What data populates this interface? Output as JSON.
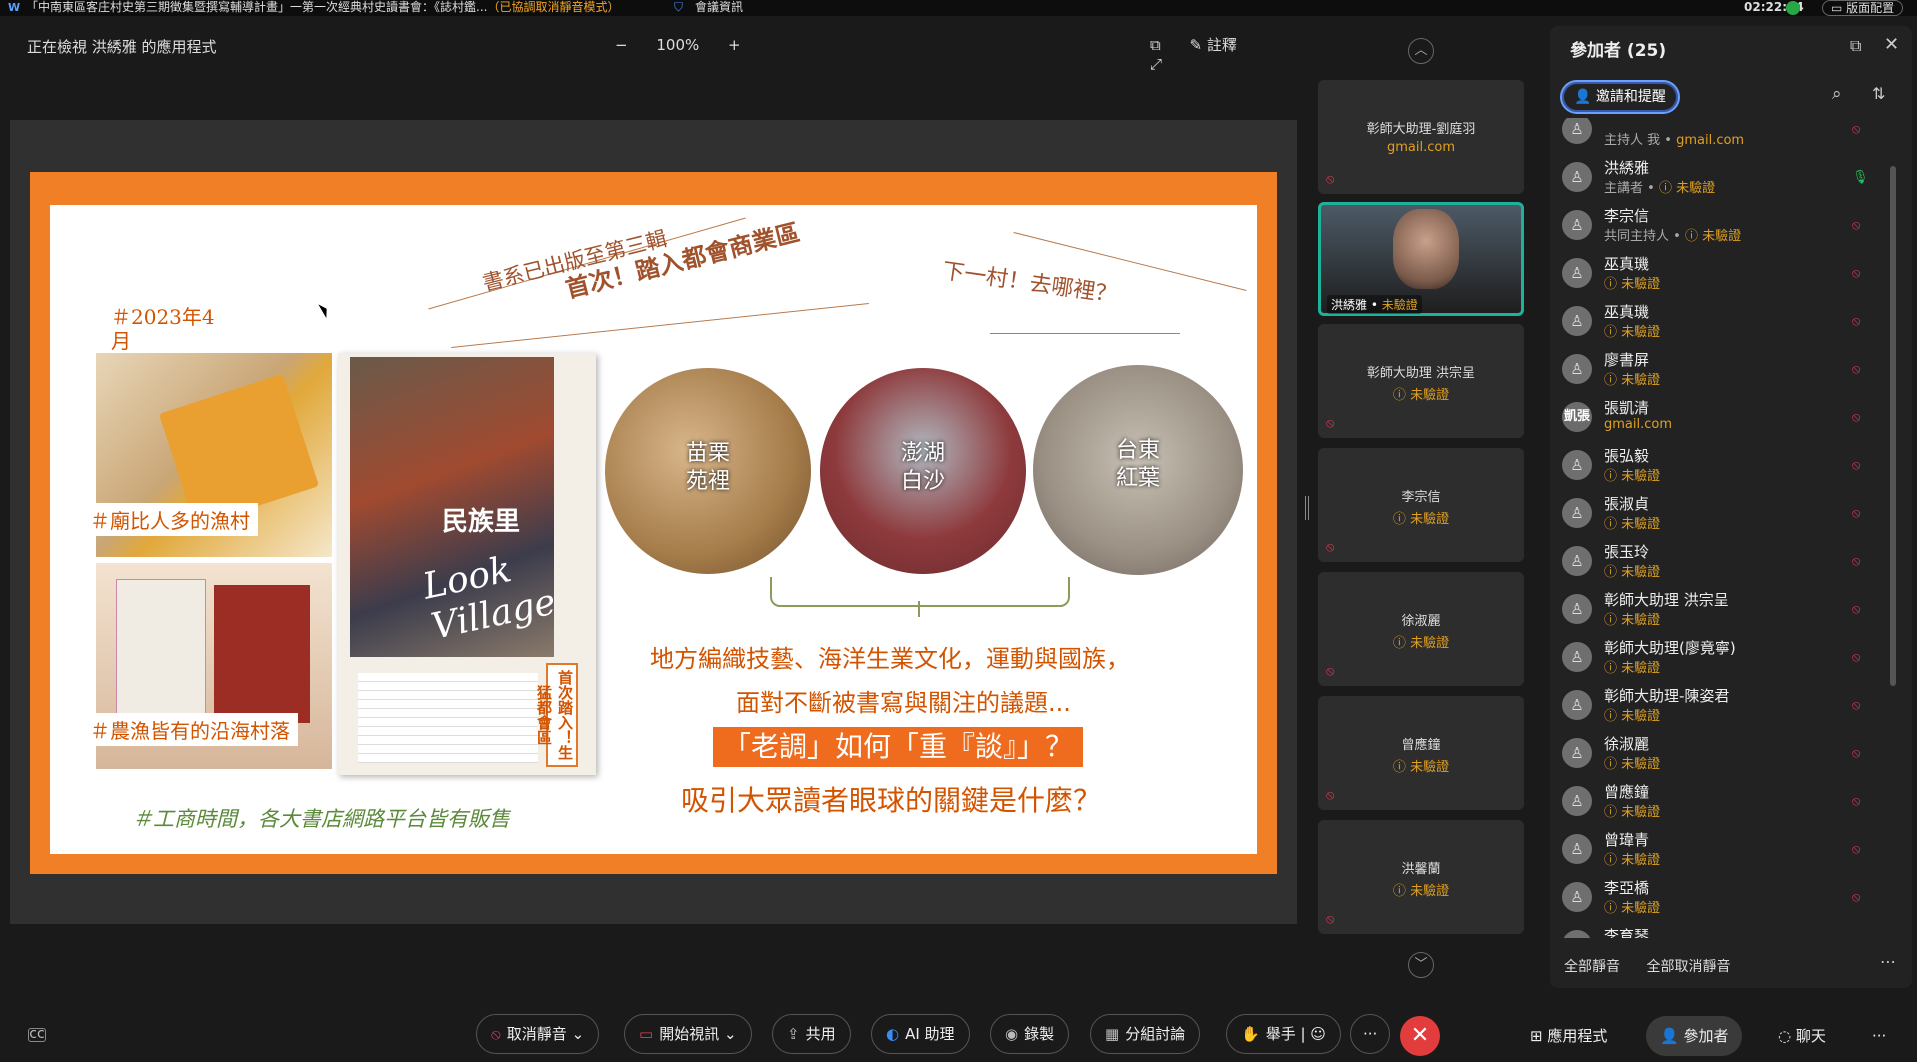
{
  "window": {
    "title": "「中南東區客庄村史第三期徵集暨撰寫輔導計畫」一第一次經典村史讀書會：《誌村鑑...",
    "title_hint": "（已協調取消靜音模式）",
    "meeting_info": "會議資訊",
    "clock": "02:22:44",
    "layout_label": "版面配置"
  },
  "viewer": {
    "viewing": "正在檢視 洪綉雅 的應用程式",
    "zoom_minus": "−",
    "zoom": "100%",
    "zoom_plus": "+",
    "annotate": "註釋"
  },
  "slide": {
    "date": "＃2023年4月",
    "headline1": "書系已出版至第三輯",
    "headline2": "首次！踏入都會商業區",
    "headline3": "下一村！去哪裡？",
    "label1": "＃廟比人多的漁村",
    "label2": "＃農漁皆有的沿海村落",
    "book_title": "民族里",
    "book_look": "Look Village",
    "book_tag": "首次踏入！生猛都會區",
    "circle1": "苗栗\n苑裡",
    "circle2": "澎湖\n白沙",
    "circle3": "台東\n紅葉",
    "text1": "地方編織技藝、海洋生業文化，運動與國族，",
    "text2": "面對不斷被書寫與關注的議題...",
    "text3": "「老調」如何「重『談』」？",
    "text4": "吸引大眾讀者眼球的關鍵是什麼？",
    "text5": "＃工商時間，各大書店網路平台皆有販售"
  },
  "tiles": [
    {
      "name": "彰師大助理-劉庭羽",
      "sub": "gmail.com",
      "sub_type": "email"
    },
    {
      "name": "洪綉雅",
      "sub": "未驗證",
      "video": true
    },
    {
      "name": "彰師大助理 洪宗呈",
      "sub": "未驗證"
    },
    {
      "name": "李宗信",
      "sub": "未驗證"
    },
    {
      "name": "徐淑麗",
      "sub": "未驗證"
    },
    {
      "name": "曾應鐘",
      "sub": "未驗證"
    },
    {
      "name": "洪馨蘭",
      "sub": "未驗證"
    }
  ],
  "panel": {
    "title": "參加者 (25)",
    "invite": "邀請和提醒",
    "mute_all": "全部靜音",
    "unmute_all": "全部取消靜音",
    "participants": [
      {
        "name": "",
        "role": "主持人 我 • ",
        "status": "gmail.com",
        "avatar": "",
        "mic": "muted"
      },
      {
        "name": "洪綉雅",
        "role": "主講者 • ",
        "status": "未驗證",
        "avatar": "",
        "mic": "on"
      },
      {
        "name": "李宗信",
        "role": "共同主持人 • ",
        "status": "未驗證",
        "avatar": "",
        "mic": "muted"
      },
      {
        "name": "巫真璣",
        "role": "",
        "status": "未驗證",
        "avatar": "",
        "mic": "muted"
      },
      {
        "name": "巫真璣",
        "role": "",
        "status": "未驗證",
        "avatar": "",
        "mic": "muted"
      },
      {
        "name": "廖書屏",
        "role": "",
        "status": "未驗證",
        "avatar": "",
        "mic": "muted"
      },
      {
        "name": "張凱清",
        "role": "",
        "status": "gmail.com",
        "avatar": "凱張",
        "mic": "muted"
      },
      {
        "name": "張弘毅",
        "role": "",
        "status": "未驗證",
        "avatar": "",
        "mic": "muted"
      },
      {
        "name": "張淑貞",
        "role": "",
        "status": "未驗證",
        "avatar": "",
        "mic": "muted"
      },
      {
        "name": "張玉玲",
        "role": "",
        "status": "未驗證",
        "avatar": "",
        "mic": "muted"
      },
      {
        "name": "彰師大助理 洪宗呈",
        "role": "",
        "status": "未驗證",
        "avatar": "",
        "mic": "muted"
      },
      {
        "name": "彰師大助理(廖竟寧)",
        "role": "",
        "status": "未驗證",
        "avatar": "",
        "mic": "muted"
      },
      {
        "name": "彰師大助理-陳姿君",
        "role": "",
        "status": "未驗證",
        "avatar": "",
        "mic": "muted"
      },
      {
        "name": "徐淑麗",
        "role": "",
        "status": "未驗證",
        "avatar": "",
        "mic": "muted"
      },
      {
        "name": "曾應鐘",
        "role": "",
        "status": "未驗證",
        "avatar": "",
        "mic": "muted"
      },
      {
        "name": "曾瑋青",
        "role": "",
        "status": "未驗證",
        "avatar": "",
        "mic": "muted"
      },
      {
        "name": "李亞橋",
        "role": "",
        "status": "未驗證",
        "avatar": "",
        "mic": "muted"
      },
      {
        "name": "李育琴",
        "role": "",
        "status": "",
        "avatar": "",
        "mic": "muted"
      }
    ]
  },
  "toolbar": {
    "unmute": "取消靜音",
    "video": "開始視訊",
    "share": "共用",
    "ai": "AI 助理",
    "record": "錄製",
    "breakout": "分組討論",
    "raise": "舉手",
    "more": "···",
    "apps": "應用程式",
    "participants": "參加者",
    "chat": "聊天",
    "more2": "···"
  }
}
